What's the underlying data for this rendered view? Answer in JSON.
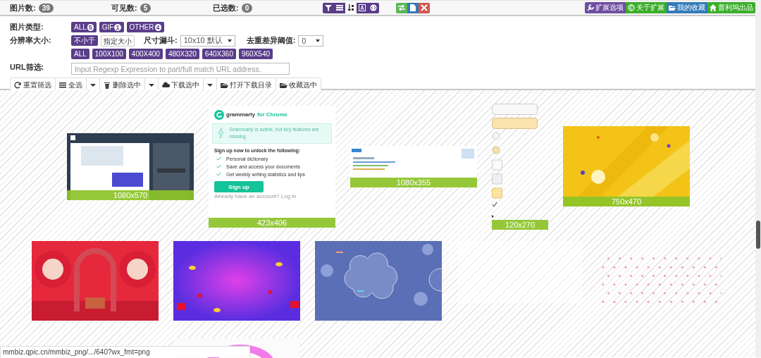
{
  "header": {
    "counts": [
      {
        "label": "图片数:",
        "value": "39"
      },
      {
        "label": "可见数:",
        "value": "5"
      },
      {
        "label": "已选数:",
        "value": "0"
      }
    ],
    "view_tools": [
      {
        "kind": "filter",
        "selected": false
      },
      {
        "kind": "rows",
        "selected": false
      },
      {
        "kind": "sort",
        "selected": true
      },
      {
        "kind": "font",
        "selected": false
      },
      {
        "kind": "code",
        "selected": false
      }
    ],
    "actions": [
      {
        "kind": "swap",
        "color": "#5cb85c"
      },
      {
        "kind": "file",
        "color": "#337ab7"
      },
      {
        "kind": "close",
        "color": "#d9534f"
      }
    ],
    "links": [
      {
        "label": "扩展选项",
        "kind": "wrench",
        "color": "#6f4ea0"
      },
      {
        "label": "关于扩展",
        "kind": "copyright",
        "color": "#3aae2a"
      },
      {
        "label": "我的收藏",
        "kind": "folder",
        "color": "#337ab7"
      },
      {
        "label": "普利坞出品",
        "kind": "home",
        "color": "#3aae2a"
      }
    ]
  },
  "filters": {
    "type": {
      "label": "图片类型:",
      "options": [
        {
          "label": "ALL",
          "count": "5"
        },
        {
          "label": "GIF",
          "count": "1"
        },
        {
          "label": "OTHER",
          "count": "4"
        }
      ]
    },
    "resolution": {
      "label": "分辨率大小:",
      "modes": [
        {
          "label": "不小于",
          "selected": true
        },
        {
          "label": "指定大小",
          "selected": false
        }
      ],
      "funnel_label": "尺寸漏斗:",
      "funnel_value": "10x10 默认",
      "dedupe_label": "去重差异阈值:",
      "dedupe_value": "0",
      "sizes": [
        "ALL",
        "100X100",
        "400X400",
        "480X320",
        "640X360",
        "960X540"
      ]
    },
    "url": {
      "label": "URL筛选:",
      "placeholder": "Input Regexp Expression to part/full match URL address."
    },
    "buttons": [
      {
        "kind": "refresh",
        "label": "重置筛选"
      },
      {
        "kind": "list",
        "label": "全选"
      },
      {
        "kind": "caret"
      },
      {
        "kind": "trash",
        "label": "删除选中"
      },
      {
        "kind": "caret"
      },
      {
        "kind": "cloud",
        "label": "下载选中"
      },
      {
        "kind": "caret"
      },
      {
        "kind": "folder",
        "label": "打开下载目录"
      },
      {
        "kind": "folder",
        "label": "收藏选中"
      }
    ]
  },
  "gallery": {
    "row_1": [
      {
        "kind": "picture",
        "size": "1080x570"
      },
      {
        "kind": "grammarly",
        "size": "423x406",
        "brand": "grammarly",
        "product": "for Chrome",
        "alert": "Grammarly is active, but key features are missing",
        "heading": "Sign up now to unlock the following:",
        "features": [
          "Personal dictionary",
          "Save and access your documents",
          "Get weekly writing statistics and tips"
        ],
        "button": "Sign up",
        "footer": "Already have an account? Log in"
      },
      {
        "kind": "picture",
        "size": "1080x355"
      },
      {
        "kind": "sprite",
        "size": "120x270"
      },
      {
        "kind": "picture",
        "size": "750x470"
      }
    ],
    "row_2": [
      {
        "kind": "picture"
      },
      {
        "kind": "picture"
      },
      {
        "kind": "picture"
      },
      {
        "kind": "blank"
      },
      {
        "kind": "dots"
      }
    ],
    "row_3": [
      {
        "kind": "picture"
      }
    ]
  },
  "status_bar": "mmbiz.qpic.cn/mmbiz_png/.../640?wx_fmt=png"
}
